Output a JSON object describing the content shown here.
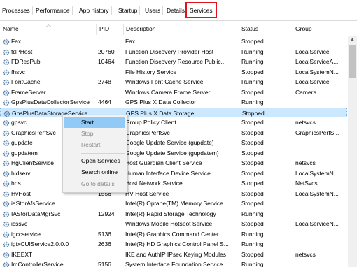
{
  "tabs": [
    {
      "label": "Processes"
    },
    {
      "label": "Performance"
    },
    {
      "label": "App history"
    },
    {
      "label": "Startup"
    },
    {
      "label": "Users"
    },
    {
      "label": "Details"
    },
    {
      "label": "Services"
    }
  ],
  "active_tab": "Services",
  "columns": {
    "name": "Name",
    "pid": "PID",
    "description": "Description",
    "status": "Status",
    "group": "Group"
  },
  "rows": [
    {
      "name": "Fax",
      "pid": "",
      "description": "Fax",
      "status": "Stopped",
      "group": ""
    },
    {
      "name": "fdPHost",
      "pid": "20760",
      "description": "Function Discovery Provider Host",
      "status": "Running",
      "group": "LocalService"
    },
    {
      "name": "FDResPub",
      "pid": "10464",
      "description": "Function Discovery Resource Public...",
      "status": "Running",
      "group": "LocalServiceA..."
    },
    {
      "name": "fhsvc",
      "pid": "",
      "description": "File History Service",
      "status": "Stopped",
      "group": "LocalSystemN..."
    },
    {
      "name": "FontCache",
      "pid": "2748",
      "description": "Windows Font Cache Service",
      "status": "Running",
      "group": "LocalService"
    },
    {
      "name": "FrameServer",
      "pid": "",
      "description": "Windows Camera Frame Server",
      "status": "Stopped",
      "group": "Camera"
    },
    {
      "name": "GpsPlusDataCollectorService",
      "pid": "4464",
      "description": "GPS Plus X Data Collector",
      "status": "Running",
      "group": ""
    },
    {
      "name": "GpsPlusDataStorageService",
      "pid": "",
      "description": "GPS Plus X Data Storage",
      "status": "Stopped",
      "group": ""
    },
    {
      "name": "gpsvc",
      "pid": "",
      "description": "Group Policy Client",
      "status": "Stopped",
      "group": "netsvcs"
    },
    {
      "name": "GraphicsPerfSvc",
      "pid": "",
      "description": "GraphicsPerfSvc",
      "status": "Stopped",
      "group": "GraphicsPerfS..."
    },
    {
      "name": "gupdate",
      "pid": "",
      "description": "Google Update Service (gupdate)",
      "status": "Stopped",
      "group": ""
    },
    {
      "name": "gupdatem",
      "pid": "",
      "description": "Google Update Service (gupdatem)",
      "status": "Stopped",
      "group": ""
    },
    {
      "name": "HgClientService",
      "pid": "",
      "description": "Host Guardian Client Service",
      "status": "Stopped",
      "group": "netsvcs"
    },
    {
      "name": "hidserv",
      "pid": "",
      "description": "Human Interface Device Service",
      "status": "Stopped",
      "group": "LocalSystemN..."
    },
    {
      "name": "hns",
      "pid": "",
      "description": "Host Network Service",
      "status": "Stopped",
      "group": "NetSvcs"
    },
    {
      "name": "HvHost",
      "pid": "1556",
      "description": "HV Host Service",
      "status": "Stopped",
      "group": "LocalSystemN..."
    },
    {
      "name": "iaStorAfsService",
      "pid": "",
      "description": "Intel(R) Optane(TM) Memory Service",
      "status": "Stopped",
      "group": ""
    },
    {
      "name": "IAStorDataMgrSvc",
      "pid": "12924",
      "description": "Intel(R) Rapid Storage Technology",
      "status": "Running",
      "group": ""
    },
    {
      "name": "icssvc",
      "pid": "",
      "description": "Windows Mobile Hotspot Service",
      "status": "Stopped",
      "group": "LocalServiceN..."
    },
    {
      "name": "igccservice",
      "pid": "5136",
      "description": "Intel(R) Graphics Command Center ...",
      "status": "Running",
      "group": ""
    },
    {
      "name": "igfxCUIService2.0.0.0",
      "pid": "2636",
      "description": "Intel(R) HD Graphics Control Panel S...",
      "status": "Running",
      "group": ""
    },
    {
      "name": "IKEEXT",
      "pid": "",
      "description": "IKE and AuthIP IPsec Keying Modules",
      "status": "Stopped",
      "group": "netsvcs"
    },
    {
      "name": "ImControllerService",
      "pid": "5156",
      "description": "System Interface Foundation Service",
      "status": "Running",
      "group": ""
    }
  ],
  "selected_row": "GpsPlusDataStorageService",
  "context_menu": {
    "items": [
      {
        "label": "Start",
        "enabled": true,
        "highlighted": true
      },
      {
        "label": "Stop",
        "enabled": false
      },
      {
        "label": "Restart",
        "enabled": false
      },
      {
        "separator": true
      },
      {
        "label": "Open Services",
        "enabled": true
      },
      {
        "label": "Search online",
        "enabled": true
      },
      {
        "label": "Go to details",
        "enabled": false
      }
    ]
  },
  "icons": {
    "service": "gear-icon",
    "sort": "chevron-up-icon",
    "scroll_up": "arrow-up-icon"
  },
  "colors": {
    "selection": "#cce8ff",
    "menu_highlight": "#91c9f7",
    "active_tab_border": "#e0121b"
  }
}
